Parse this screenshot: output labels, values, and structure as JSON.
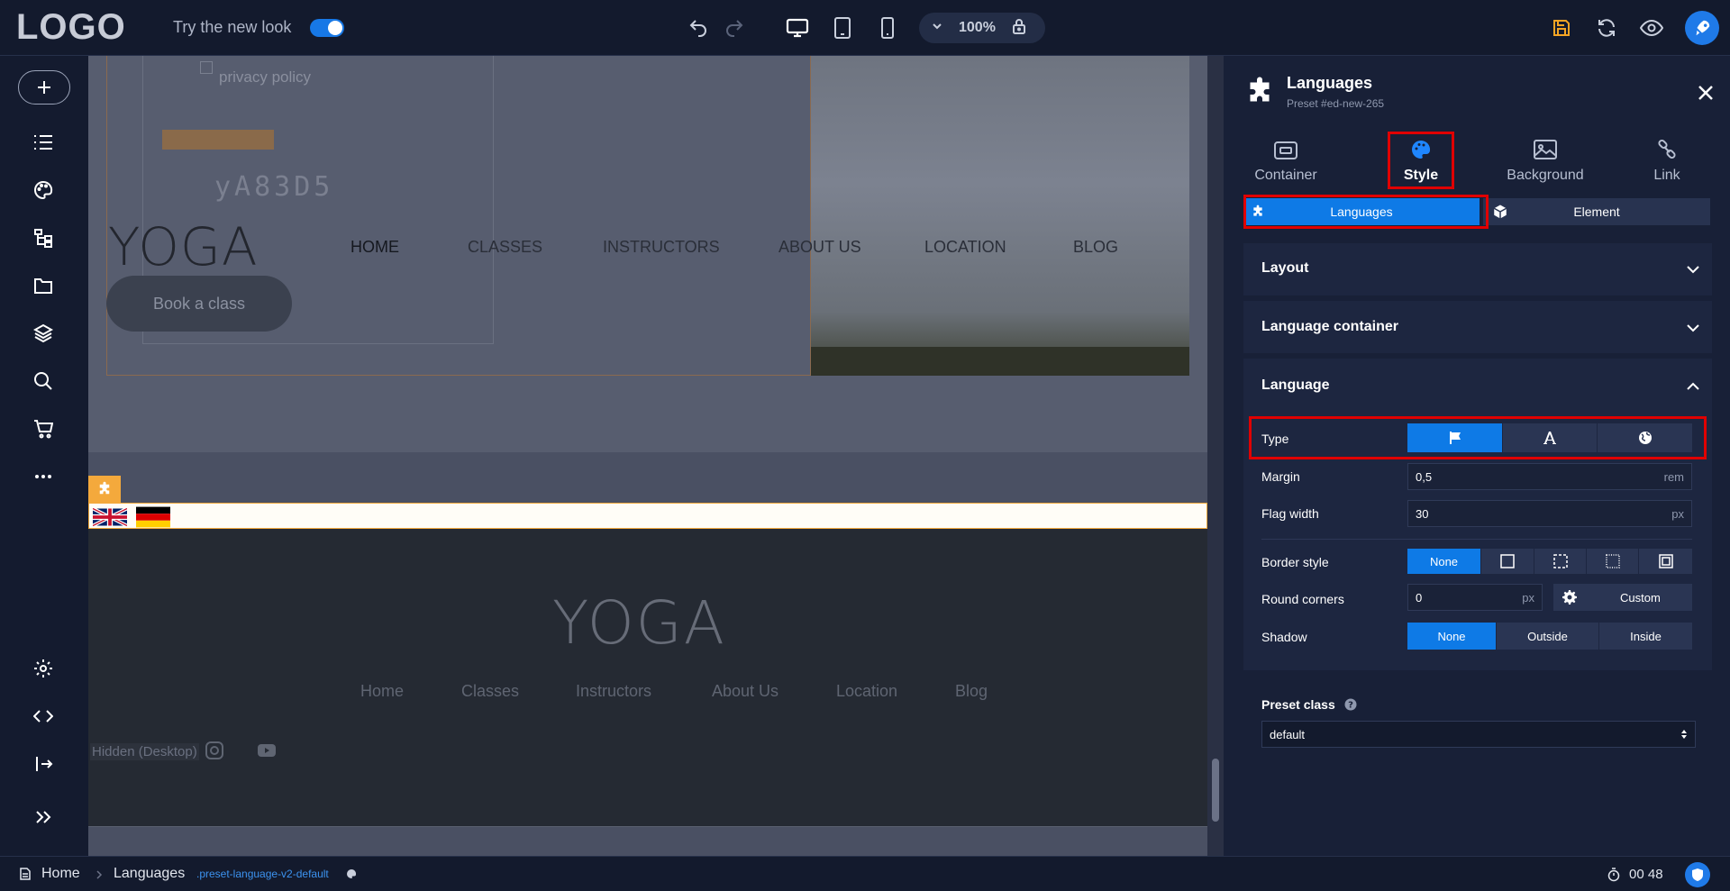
{
  "topbar": {
    "logo": "LOGO",
    "try_new_look": "Try the new look",
    "zoom": "100%"
  },
  "canvas": {
    "privacy_text": "privacy policy",
    "captcha_text": "yA83D5",
    "yoga_logo": "YOGA",
    "nav": [
      "HOME",
      "CLASSES",
      "INSTRUCTORS",
      "ABOUT US",
      "LOCATION",
      "BLOG"
    ],
    "book_button": "Book a class",
    "footer_logo": "YOGA",
    "footer_links": [
      "Home",
      "Classes",
      "Instructors",
      "About Us",
      "Location",
      "Blog"
    ],
    "hidden_label": "Hidden (Desktop)"
  },
  "panel": {
    "title": "Languages",
    "subtitle": "Preset #ed-new-265",
    "tabs": [
      "Container",
      "Style",
      "Background",
      "Link"
    ],
    "subtabs": [
      "Languages",
      "Element"
    ],
    "sections": {
      "layout": "Layout",
      "language_container": "Language container",
      "language": "Language"
    },
    "type_label": "Type",
    "margin_label": "Margin",
    "margin_value": "0,5",
    "margin_unit": "rem",
    "flag_width_label": "Flag width",
    "flag_width_value": "30",
    "flag_width_unit": "px",
    "border_style_label": "Border style",
    "border_none": "None",
    "round_corners_label": "Round corners",
    "round_corners_value": "0",
    "round_corners_unit": "px",
    "custom_label": "Custom",
    "shadow_label": "Shadow",
    "shadow_options": [
      "None",
      "Outside",
      "Inside"
    ],
    "preset_class_label": "Preset class",
    "preset_class_value": "default"
  },
  "bottombar": {
    "home": "Home",
    "languages": "Languages",
    "class_name": ".preset-language-v2-default",
    "timer": "00 48"
  },
  "colors": {
    "accent": "#0e7ae6",
    "highlight": "#e00000",
    "marker": "#f4a93c"
  }
}
